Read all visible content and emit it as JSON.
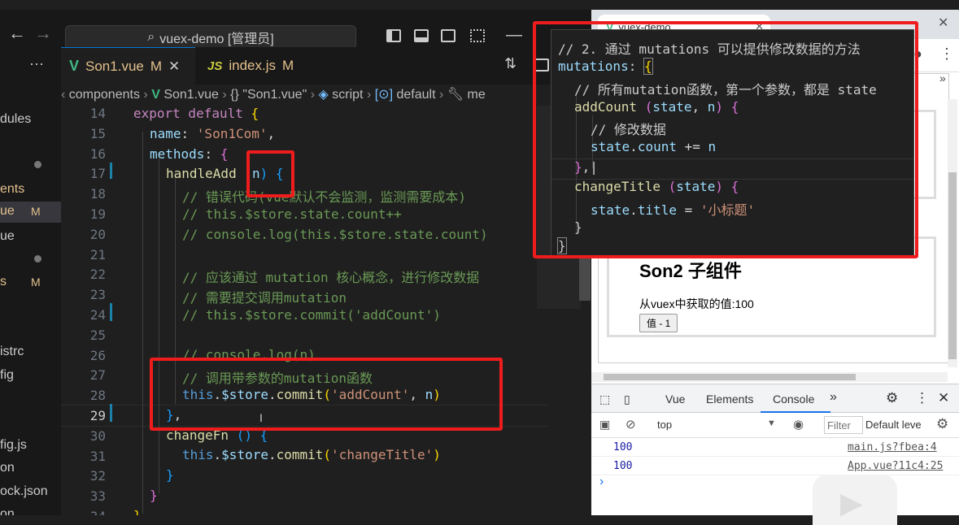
{
  "vscode": {
    "search": "vuex-demo [管理员]",
    "tabs": [
      {
        "icon": "V",
        "name": "Son1.vue",
        "mod": "M",
        "close": "✕"
      },
      {
        "icon": "JS",
        "name": "index.js",
        "mod": "M"
      }
    ],
    "breadcrumb": {
      "a": "components",
      "b": "Son1.vue",
      "c": "{} \"Son1.vue\"",
      "d": "script",
      "e": "default",
      "f": "me"
    },
    "sidebar": [
      {
        "label": "dules"
      },
      {
        "label": "ents"
      },
      {
        "label": "ue",
        "badge": "M"
      },
      {
        "label": "ue"
      },
      {
        "label": "s",
        "badge": "M"
      },
      {
        "label": "istrc"
      },
      {
        "label": "fig"
      },
      {
        "label": "fig.js"
      },
      {
        "label": "on"
      },
      {
        "label": "ock.json"
      },
      {
        "label": "on"
      }
    ],
    "line_numbers": [
      "14",
      "15",
      "16",
      "17",
      "18",
      "19",
      "20",
      "21",
      "22",
      "23",
      "24",
      "25",
      "26",
      "27",
      "28",
      "29",
      "30",
      "31",
      "32",
      "33",
      "34"
    ],
    "code": {
      "l14a": "export default",
      "l14b": " {",
      "l15a": "name",
      "l15b": ": ",
      "l15c": "'Son1Com'",
      "l15d": ",",
      "l16a": "methods",
      "l16b": ": ",
      "l16c": "{",
      "l17a": "handleAdd ",
      "l17b": "(",
      "l17c": "n",
      "l17d": ")",
      "l17e": " {",
      "l18": "// 错误代码(vue默认不会监测，监测需要成本)",
      "l19": "// this.$store.state.count++",
      "l20": "// console.log(this.$store.state.count)",
      "l22": "// 应该通过 mutation 核心概念，进行修改数据",
      "l23": "// 需要提交调用mutation",
      "l24": "// this.$store.commit('addCount')",
      "l26": "// console.log(n)",
      "l27": "// 调用带参数的mutation函数",
      "l28a": "this",
      ".l28b": "",
      "l28c": "$store",
      "l28d": "commit",
      "l28e": "'addCount'",
      "l28f": "n",
      "l29a": "}",
      "l29b": ",",
      "l30a": "changeFn ",
      "l30b": "() {",
      "l31a": "this",
      "l31c": "$store",
      "l31d": "commit",
      "l31e": "'changeTitle'",
      "l32": "}",
      "l33": "}",
      "l34": "}"
    }
  },
  "popup": {
    "p1": "// 2. 通过 mutations 可以提供修改数据的方法",
    "p2a": "mutations",
    "p2b": ": ",
    "p2c": "{",
    "p3": "// 所有mutation函数，第一个参数，都是 state",
    "p4a": "addCount ",
    "p4b": "(",
    "p4c": "state",
    "p4d": ", ",
    "p4e": "n",
    "p4f": ")",
    "p4g": " {",
    "p5": "// 修改数据",
    "p6a": "state",
    "p6b": ".",
    "p6c": "count",
    "p6d": " += ",
    "p6e": "n",
    "p7a": "}",
    "p7b": ",",
    "p8a": "changeTitle ",
    "p8b": "(",
    "p8c": "state",
    "p8d": ")",
    "p8e": " {",
    "p9a": "state",
    "p9b": ".",
    "p9c": "title",
    "p9d": " = ",
    "p9e": "'小标题'",
    "p10": "}",
    "p11": "}"
  },
  "browser": {
    "tab_title": "vuex-demo",
    "son2_title": "Son2 子组件",
    "son2_text": "从vuex中获取的值:100",
    "son2_button": "值 - 1",
    "devtools_tabs": [
      "Vue",
      "Elements",
      "Console"
    ],
    "more": "»",
    "context": "top",
    "filter_placeholder": "Filter",
    "levels": "Default leve",
    "console_rows": [
      {
        "value": "100",
        "source": "main.js?fbea:4"
      },
      {
        "value": "100",
        "source": "App.vue?11c4:25"
      }
    ],
    "prompt": "›"
  },
  "colors": {
    "highlight": "#ee1c1c",
    "vue_green": "#41b883"
  }
}
